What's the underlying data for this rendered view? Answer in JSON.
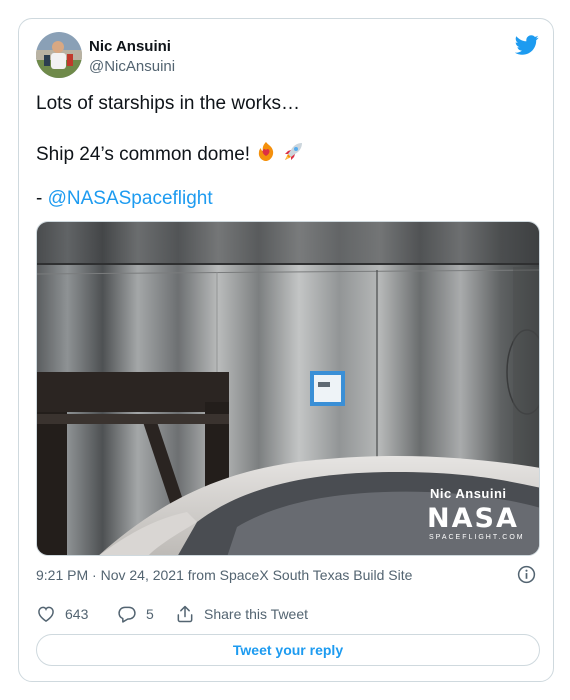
{
  "author": {
    "name": "Nic Ansuini",
    "handle": "@NicAnsuini",
    "avatar_icon": "avatar-photo"
  },
  "tweet": {
    "line1": "Lots of starships in the works…",
    "line2": "Ship 24’s common dome!",
    "line2_emojis": [
      "heart-on-fire-emoji",
      "rocket-emoji"
    ],
    "line3_prefix": "- ",
    "mention": "@NASASpaceflight"
  },
  "media": {
    "watermark_line1": "Nic Ansuini",
    "watermark_logo": "NASA",
    "watermark_line3": "SPACEFLIGHT.COM"
  },
  "meta": {
    "timestamp": "9:21 PM · Nov 24, 2021 from SpaceX South Texas Build Site",
    "info_icon": "info-icon"
  },
  "actions": {
    "like_count": "643",
    "reply_count": "5",
    "share_label": "Share this Tweet"
  },
  "reply_button_label": "Tweet your reply",
  "colors": {
    "accent": "#1d9bf0",
    "secondary_text": "#536471",
    "border": "#cfd9de"
  }
}
